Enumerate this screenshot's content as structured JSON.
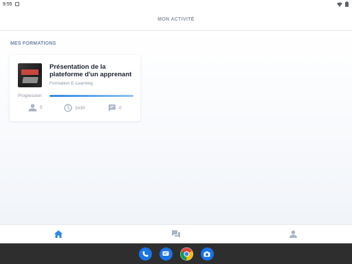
{
  "status_bar": {
    "time": "9:55"
  },
  "header": {
    "title": "MON ACTIVITÉ"
  },
  "section": {
    "title": "MES FORMATIONS"
  },
  "course": {
    "title": "Présentation de la plateforme d'un apprenant",
    "subtitle": "Formation E-Learning",
    "progress_label": "Progression",
    "progress_fraction": 1.0,
    "learners": "5",
    "duration": "1h30",
    "comments": "0"
  },
  "nav": {
    "items": [
      "home-icon",
      "chat-icon",
      "profile-icon"
    ],
    "active": 0
  },
  "colors": {
    "accent": "#2e8ae6",
    "inactive": "#a9b4c4",
    "title": "#1b2233"
  },
  "dock": {
    "apps": [
      "phone-icon",
      "messages-icon",
      "chrome-icon",
      "camera-icon"
    ]
  }
}
